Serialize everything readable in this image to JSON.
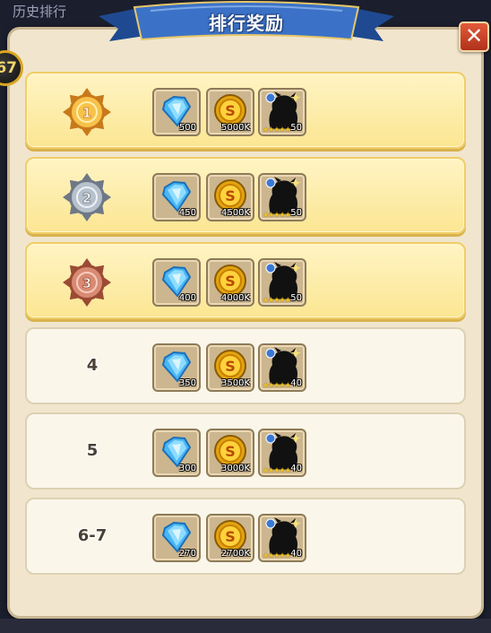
{
  "background": {
    "history_label": "历史排行",
    "level": "67"
  },
  "dialog": {
    "title": "排行奖励",
    "close_label": "✕"
  },
  "colors": {
    "gold_row": "#fbe692",
    "plain_row": "#faf6ea",
    "banner": "#2f62b4",
    "close": "#c63e22"
  },
  "rewards": [
    {
      "rank": "1",
      "medal": "gold",
      "diamond": "500",
      "coins": "5000K",
      "hero": "50",
      "stars": "★★★★★"
    },
    {
      "rank": "2",
      "medal": "silver",
      "diamond": "450",
      "coins": "4500K",
      "hero": "50",
      "stars": "★★★★★"
    },
    {
      "rank": "3",
      "medal": "bronze",
      "diamond": "400",
      "coins": "4000K",
      "hero": "50",
      "stars": "★★★★★"
    },
    {
      "rank": "4",
      "medal": "none",
      "diamond": "350",
      "coins": "3500K",
      "hero": "40",
      "stars": "★★★★★"
    },
    {
      "rank": "5",
      "medal": "none",
      "diamond": "300",
      "coins": "3000K",
      "hero": "40",
      "stars": "★★★★★"
    },
    {
      "rank": "6-7",
      "medal": "none",
      "diamond": "270",
      "coins": "2700K",
      "hero": "40",
      "stars": "★★★★★"
    }
  ]
}
